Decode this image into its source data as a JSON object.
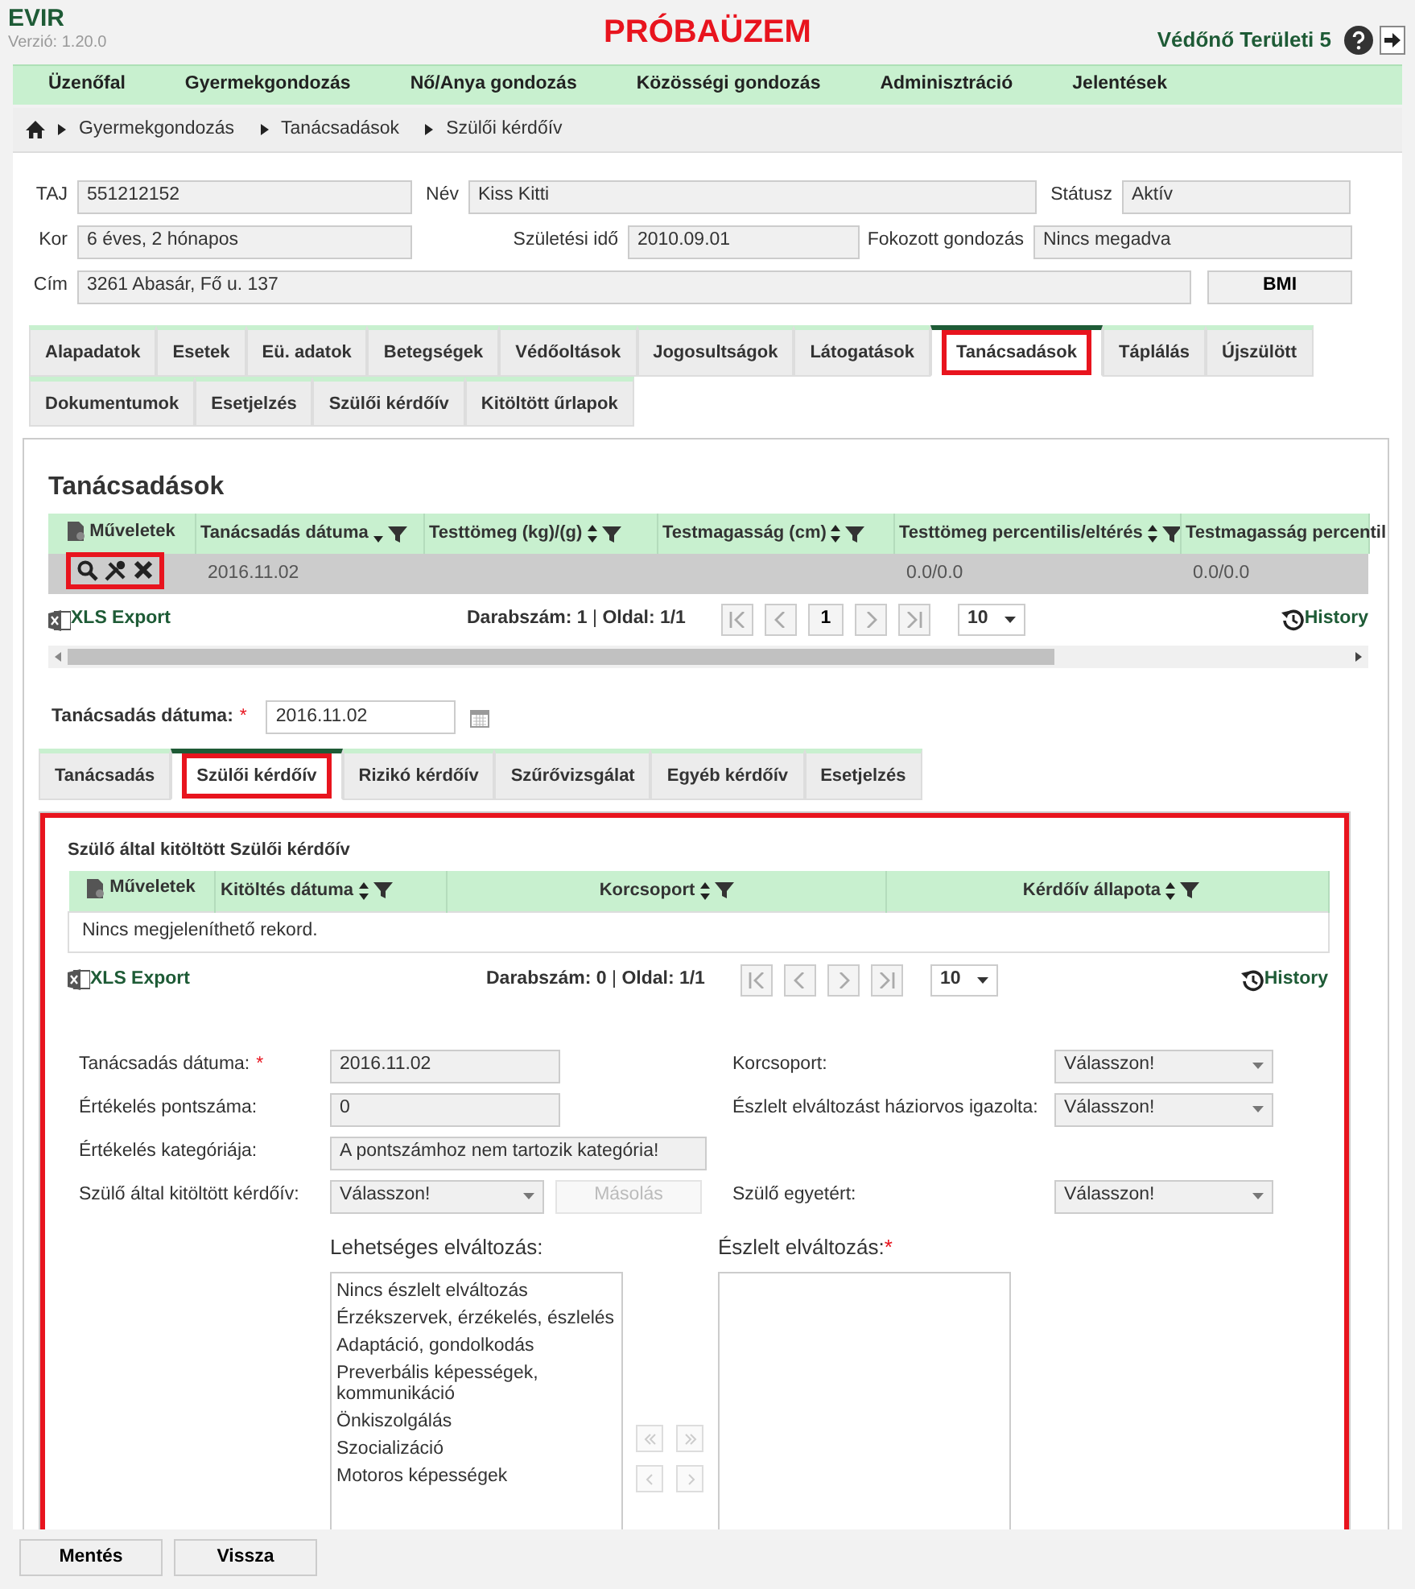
{
  "app": {
    "name": "EVIR",
    "version": "Verzió: 1.20.0",
    "banner": "PRÓBAÜZEM",
    "user": "Védőnő Területi 5"
  },
  "menu": [
    "Üzenőfal",
    "Gyermekgondozás",
    "Nő/Anya gondozás",
    "Közösségi gondozás",
    "Adminisztráció",
    "Jelentések"
  ],
  "breadcrumb": [
    "Gyermekgondozás",
    "Tanácsadások",
    "Szülői kérdőív"
  ],
  "patient": {
    "rows": [
      [
        {
          "label": "TAJ",
          "value": "551212152"
        },
        {
          "label": "Név",
          "value": "Kiss Kitti"
        },
        {
          "label": "Státusz",
          "value": "Aktív"
        }
      ],
      [
        {
          "label": "Kor",
          "value": "6 éves, 2 hónapos"
        },
        {
          "label": "Születési idő",
          "value": "2010.09.01"
        },
        {
          "label": "Fokozott gondozás",
          "value": "Nincs megadva"
        }
      ],
      [
        {
          "label": "Cím",
          "value": "3261 Abasár, Fő u. 137"
        }
      ]
    ],
    "button": "BMI"
  },
  "tabs": [
    [
      {
        "label": "Alapadatok",
        "selected": false,
        "highlighted": false
      },
      {
        "label": "Esetek",
        "selected": false,
        "highlighted": false
      },
      {
        "label": "Eü. adatok",
        "selected": false,
        "highlighted": false
      },
      {
        "label": "Betegségek",
        "selected": false,
        "highlighted": false
      },
      {
        "label": "Védőoltások",
        "selected": false,
        "highlighted": false
      },
      {
        "label": "Jogosultságok",
        "selected": false,
        "highlighted": false
      },
      {
        "label": "Látogatások",
        "selected": false,
        "highlighted": false
      },
      {
        "label": "Tanácsadások",
        "selected": true,
        "highlighted": true
      },
      {
        "label": "Táplálás",
        "selected": false,
        "highlighted": false
      },
      {
        "label": "Újszülött",
        "selected": false,
        "highlighted": false
      }
    ],
    [
      {
        "label": "Dokumentumok",
        "selected": false,
        "highlighted": false
      },
      {
        "label": "Esetjelzés",
        "selected": false,
        "highlighted": false
      },
      {
        "label": "Szülői kérdőív",
        "selected": false,
        "highlighted": false
      },
      {
        "label": "Kitöltött űrlapok",
        "selected": false,
        "highlighted": false
      }
    ]
  ],
  "consultations": {
    "title": "Tanácsadások",
    "columns": [
      {
        "label": "Műveletek",
        "kind": "actions"
      },
      {
        "label": "Tanácsadás dátuma",
        "sorted": true,
        "filter": true
      },
      {
        "label": "Testtömeg (kg)/(g)",
        "sorted": false,
        "filter": true
      },
      {
        "label": "Testmagasság (cm)",
        "sorted": false,
        "filter": true
      },
      {
        "label": "Testtömeg percentilis/eltérés",
        "sorted": false,
        "filter": true
      },
      {
        "label": "Testmagasság percentil"
      }
    ],
    "rows": [
      {
        "actions_highlighted": true,
        "cells": [
          null,
          "2016.11.02",
          null,
          null,
          "0.0/0.0",
          "0.0/0.0"
        ]
      }
    ],
    "pager": {
      "export": "XLS Export",
      "count": "**Darabszám: 1** | **Oldal: 1/1**",
      "page": "1",
      "page_size": "10",
      "history": "History"
    }
  },
  "date_field": {
    "label": "Tanácsadás dátuma:",
    "required_mark": "*",
    "value": "2016.11.02"
  },
  "subtabs": [
    {
      "label": "Tanácsadás",
      "selected": false,
      "highlighted": false
    },
    {
      "label": "Szülői kérdőív",
      "selected": true,
      "highlighted": true
    },
    {
      "label": "Rizikó kérdőív",
      "selected": false,
      "highlighted": false
    },
    {
      "label": "Szűrővizsgálat",
      "selected": false,
      "highlighted": false
    },
    {
      "label": "Egyéb kérdőív",
      "selected": false,
      "highlighted": false
    },
    {
      "label": "Esetjelzés",
      "selected": false,
      "highlighted": false
    }
  ],
  "questionnaire": {
    "highlighted": true,
    "title": "Szülő által kitöltött Szülői kérdőív",
    "columns": [
      {
        "label": "Műveletek",
        "kind": "actions"
      },
      {
        "label": "Kitöltés dátuma",
        "sorted": false,
        "filter": true
      },
      {
        "label": "Korcsoport",
        "sorted": false,
        "filter": true
      },
      {
        "label": "Kérdőív állapota",
        "sorted": false,
        "filter": true
      }
    ],
    "empty": "Nincs megjeleníthető rekord.",
    "pager": {
      "export": "XLS Export",
      "count": "**Darabszám: 0** | **Oldal: 1/1**",
      "page_size": "10",
      "history": "History"
    }
  },
  "form": {
    "rows": [
      {
        "label": "Tanácsadás dátuma:",
        "required_mark": "*",
        "kind": "text",
        "value": "2016.11.02",
        "right": {
          "label": "Korcsoport:",
          "value": "Válasszon!"
        }
      },
      {
        "label": "Értékelés pontszáma:",
        "kind": "text",
        "value": "0",
        "right": {
          "label": "Észlelt elváltozást háziorvos igazolta:",
          "value": "Válasszon!"
        }
      },
      {
        "label": "Értékelés kategóriája:",
        "kind": "wide",
        "value": "A pontszámhoz nem tartozik kategória!"
      },
      {
        "label": "Szülő által kitöltött kérdőív:",
        "kind": "select",
        "value": "Válasszon!",
        "button": "Másolás",
        "button_disabled": true,
        "right": {
          "label": "Szülő egyetért:",
          "value": "Válasszon!"
        }
      }
    ]
  },
  "lists": {
    "available": {
      "label": "Lehetséges elváltozás:",
      "items": [
        "Nincs észlelt elváltozás",
        "Érzékszervek, érzékelés, észlelés",
        "Adaptáció, gondolkodás",
        "Preverbális képességek, kommunikáció",
        "Önkiszolgálás",
        "Szocializáció",
        "Motoros képességek"
      ]
    },
    "chosen": {
      "label": "Észlelt elváltozás:",
      "required_mark": "*"
    }
  },
  "footer": [
    "Mentés",
    "Vissza"
  ]
}
